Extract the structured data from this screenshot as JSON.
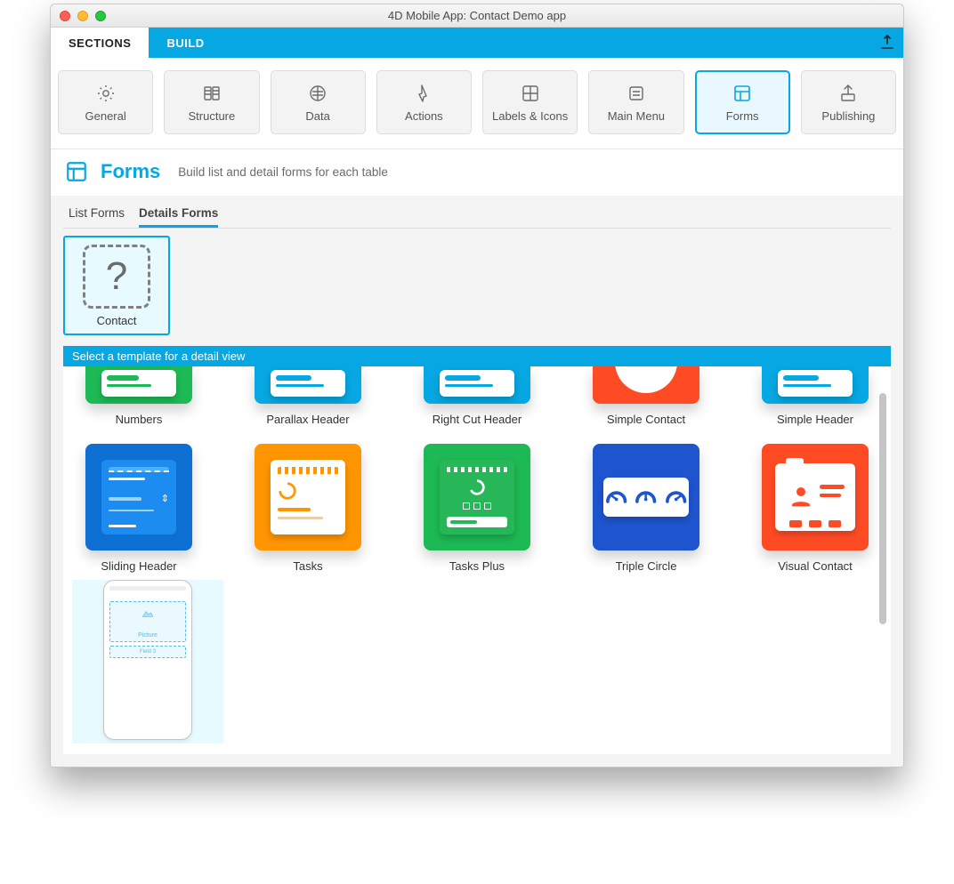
{
  "window": {
    "title": "4D Mobile App: Contact Demo app"
  },
  "tabs": {
    "sections": "SECTIONS",
    "build": "BUILD"
  },
  "toolbar": {
    "general": "General",
    "structure": "Structure",
    "data": "Data",
    "actions": "Actions",
    "labels": "Labels & Icons",
    "mainmenu": "Main Menu",
    "forms": "Forms",
    "publishing": "Publishing"
  },
  "section": {
    "title": "Forms",
    "subtitle": "Build list and detail forms for each table"
  },
  "subtabs": {
    "list": "List Forms",
    "details": "Details Forms"
  },
  "tables": [
    {
      "name": "Contact"
    }
  ],
  "banner": "Select a template for a detail view",
  "templates_row1": [
    {
      "name": "Numbers",
      "bg": "bg-green"
    },
    {
      "name": "Parallax Header",
      "bg": "bg-blue"
    },
    {
      "name": "Right Cut Header",
      "bg": "bg-blue"
    },
    {
      "name": "Simple Contact",
      "bg": "bg-red"
    },
    {
      "name": "Simple Header",
      "bg": "bg-blue"
    }
  ],
  "templates_row2": [
    {
      "name": "Sliding Header",
      "bg": "bg-blue"
    },
    {
      "name": "Tasks",
      "bg": "bg-orange"
    },
    {
      "name": "Tasks Plus",
      "bg": "bg-green"
    },
    {
      "name": "Triple Circle",
      "bg": "bg-dblue"
    },
    {
      "name": "Visual Contact",
      "bg": "bg-red"
    }
  ],
  "phone_mock": {
    "picture_label": "Picture",
    "field_label": "Field 3"
  },
  "colors": {
    "accent": "#06a7e2"
  }
}
